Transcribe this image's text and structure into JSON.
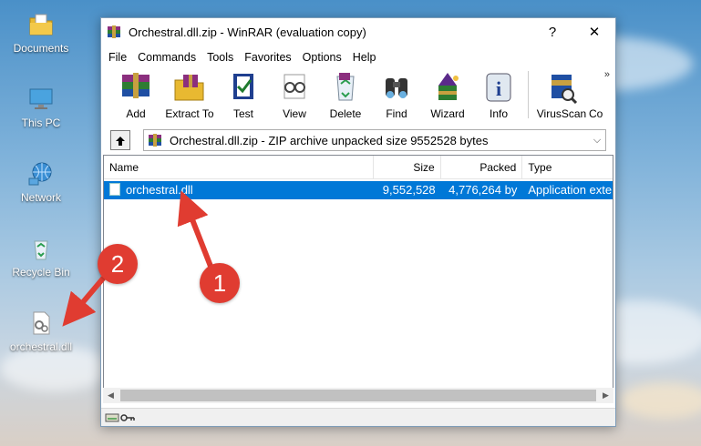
{
  "desktop": {
    "icons": [
      {
        "label": "Documents",
        "icon": "folder-icon"
      },
      {
        "label": "This PC",
        "icon": "monitor-icon"
      },
      {
        "label": "Network",
        "icon": "network-icon"
      },
      {
        "label": "Recycle Bin",
        "icon": "recycle-bin-icon"
      },
      {
        "label": "orchestral.dll",
        "icon": "dll-file-icon"
      }
    ]
  },
  "window": {
    "title": "Orchestral.dll.zip - WinRAR (evaluation copy)",
    "help_button": "?",
    "close_button": "✕"
  },
  "menu": [
    "File",
    "Commands",
    "Tools",
    "Favorites",
    "Options",
    "Help"
  ],
  "toolbar": {
    "buttons": [
      {
        "label": "Add",
        "icon": "add-books-icon"
      },
      {
        "label": "Extract To",
        "icon": "extract-folder-icon"
      },
      {
        "label": "Test",
        "icon": "test-check-icon"
      },
      {
        "label": "View",
        "icon": "view-glasses-icon"
      },
      {
        "label": "Delete",
        "icon": "delete-recycle-icon"
      },
      {
        "label": "Find",
        "icon": "find-binoculars-icon"
      },
      {
        "label": "Wizard",
        "icon": "wizard-icon"
      },
      {
        "label": "Info",
        "icon": "info-icon"
      },
      {
        "label": "VirusScan",
        "icon": "virusscan-icon"
      },
      {
        "label": "Co",
        "icon": "comment-icon"
      }
    ],
    "more": "»"
  },
  "address": {
    "text": "Orchestral.dll.zip - ZIP archive unpacked size 9552528 bytes"
  },
  "columns": [
    "Name",
    "Size",
    "Packed",
    "Type"
  ],
  "files": [
    {
      "name": "orchestral.dll",
      "size": "9,552,528",
      "packed": "4,776,264 by",
      "type": "Application exte",
      "selected": true
    }
  ],
  "annotations": {
    "badge_1": "1",
    "badge_2": "2"
  },
  "colors": {
    "selection": "#0078d7",
    "annotation": "#e03c31"
  }
}
